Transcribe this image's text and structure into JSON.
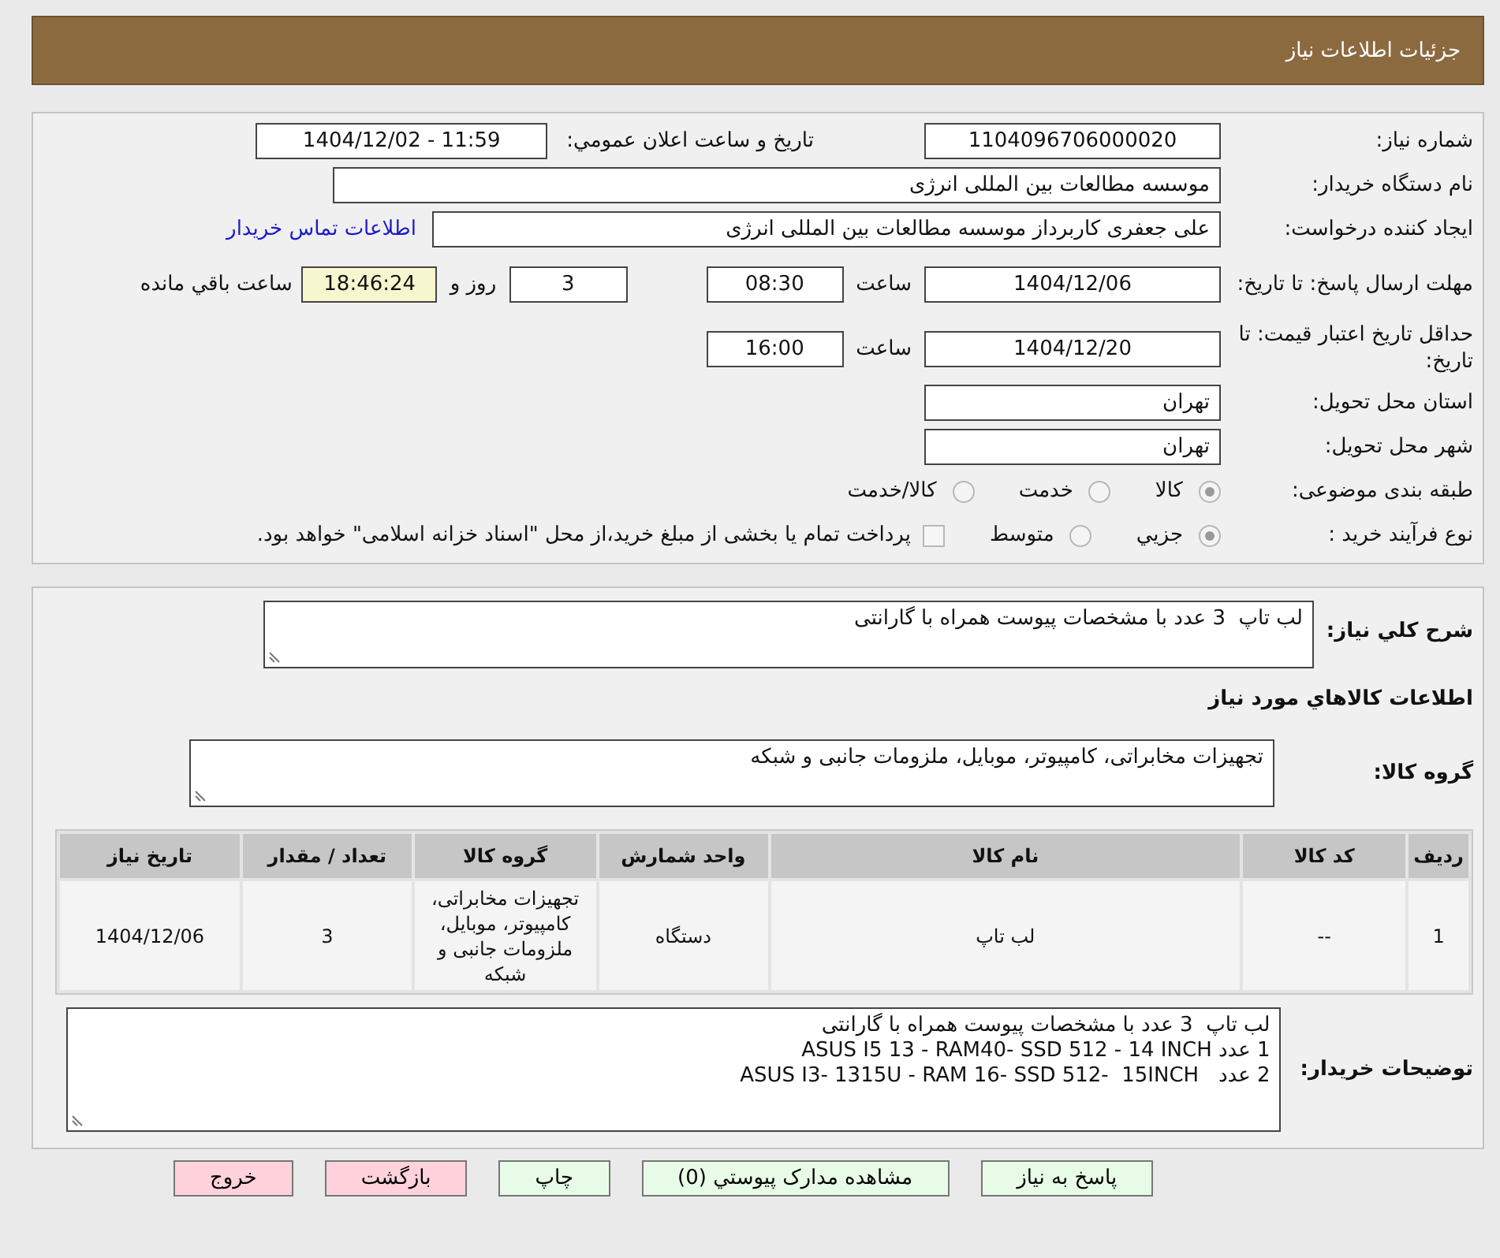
{
  "header": {
    "title": "جزئیات اطلاعات نیاز"
  },
  "need_number": {
    "label": "شماره نیاز:",
    "value": "1104096706000020"
  },
  "announce": {
    "label": "تاریخ و ساعت اعلان عمومي:",
    "value": "1404/12/02 - 11:59"
  },
  "buyer": {
    "label": "نام دستگاه خریدار:",
    "value": "موسسه مطالعات بین المللی انرژی"
  },
  "requester": {
    "label": "ایجاد کننده درخواست:",
    "value": "علی جعفری کاربرداز موسسه مطالعات بین المللی انرژی",
    "link": "اطلاعات تماس خریدار"
  },
  "deadline": {
    "label": "مهلت ارسال پاسخ: تا تاریخ:",
    "date": "1404/12/06",
    "time_label": "ساعت",
    "time": "08:30",
    "days": "3",
    "days_label": "روز و",
    "remaining": "18:46:24",
    "remaining_label": "ساعت باقي مانده"
  },
  "validity": {
    "label": "حداقل تاریخ اعتبار قیمت: تا تاریخ:",
    "date": "1404/12/20",
    "time_label": "ساعت",
    "time": "16:00"
  },
  "province": {
    "label": "استان محل تحویل:",
    "value": "تهران"
  },
  "city": {
    "label": "شهر محل تحویل:",
    "value": "تهران"
  },
  "category": {
    "label": "طبقه بندی موضوعی:",
    "options": [
      {
        "label": "کالا",
        "selected": true
      },
      {
        "label": "خدمت",
        "selected": false
      },
      {
        "label": "کالا/خدمت",
        "selected": false
      }
    ]
  },
  "process": {
    "label": "نوع فرآیند خرید :",
    "options": [
      {
        "label": "جزيي",
        "selected": true
      },
      {
        "label": "متوسط",
        "selected": false
      }
    ],
    "payment": {
      "label": "پرداخت تمام یا بخشی از مبلغ خرید،از محل \"اسناد خزانه اسلامی\" خواهد بود.",
      "checked": false
    }
  },
  "description": {
    "label": "شرح کلي نیاز:",
    "value": "لب تاپ  3 عدد با مشخصات پیوست همراه با گارانتی"
  },
  "items_title": "اطلاعات کالاهاي مورد نیاز",
  "goods_group": {
    "label": "گروه کالا:",
    "value": "تجهیزات مخابراتی، کامپیوتر، موبایل، ملزومات جانبی و شبکه"
  },
  "table": {
    "columns": [
      "ردیف",
      "کد کالا",
      "نام کالا",
      "واحد شمارش",
      "گروه کالا",
      "تعداد / مقدار",
      "تاریخ نیاز"
    ],
    "rows": [
      [
        "1",
        "--",
        "لب تاپ",
        "دستگاه",
        "تجهیزات مخابراتی، کامپیوتر، موبایل، ملزومات جانبی و شبکه",
        "3",
        "1404/12/06"
      ]
    ]
  },
  "buyer_notes": {
    "label": "توضیحات خریدار:",
    "lines": [
      "لب تاپ  3 عدد با مشخصات پیوست همراه با گارانتی",
      "1 عدد ASUS I5 13 - RAM40- SSD 512 - 14 INCH",
      "2 عدد   ASUS I3- 1315U - RAM 16- SSD 512-  15INCH"
    ]
  },
  "buttons": [
    {
      "label": "پاسخ به نیاز",
      "kind": "normal"
    },
    {
      "label": "مشاهده مدارک پیوستي (0)",
      "kind": "normal"
    },
    {
      "label": "چاپ",
      "kind": "normal"
    },
    {
      "label": "بازگشت",
      "kind": "danger"
    },
    {
      "label": "خروج",
      "kind": "danger"
    }
  ]
}
